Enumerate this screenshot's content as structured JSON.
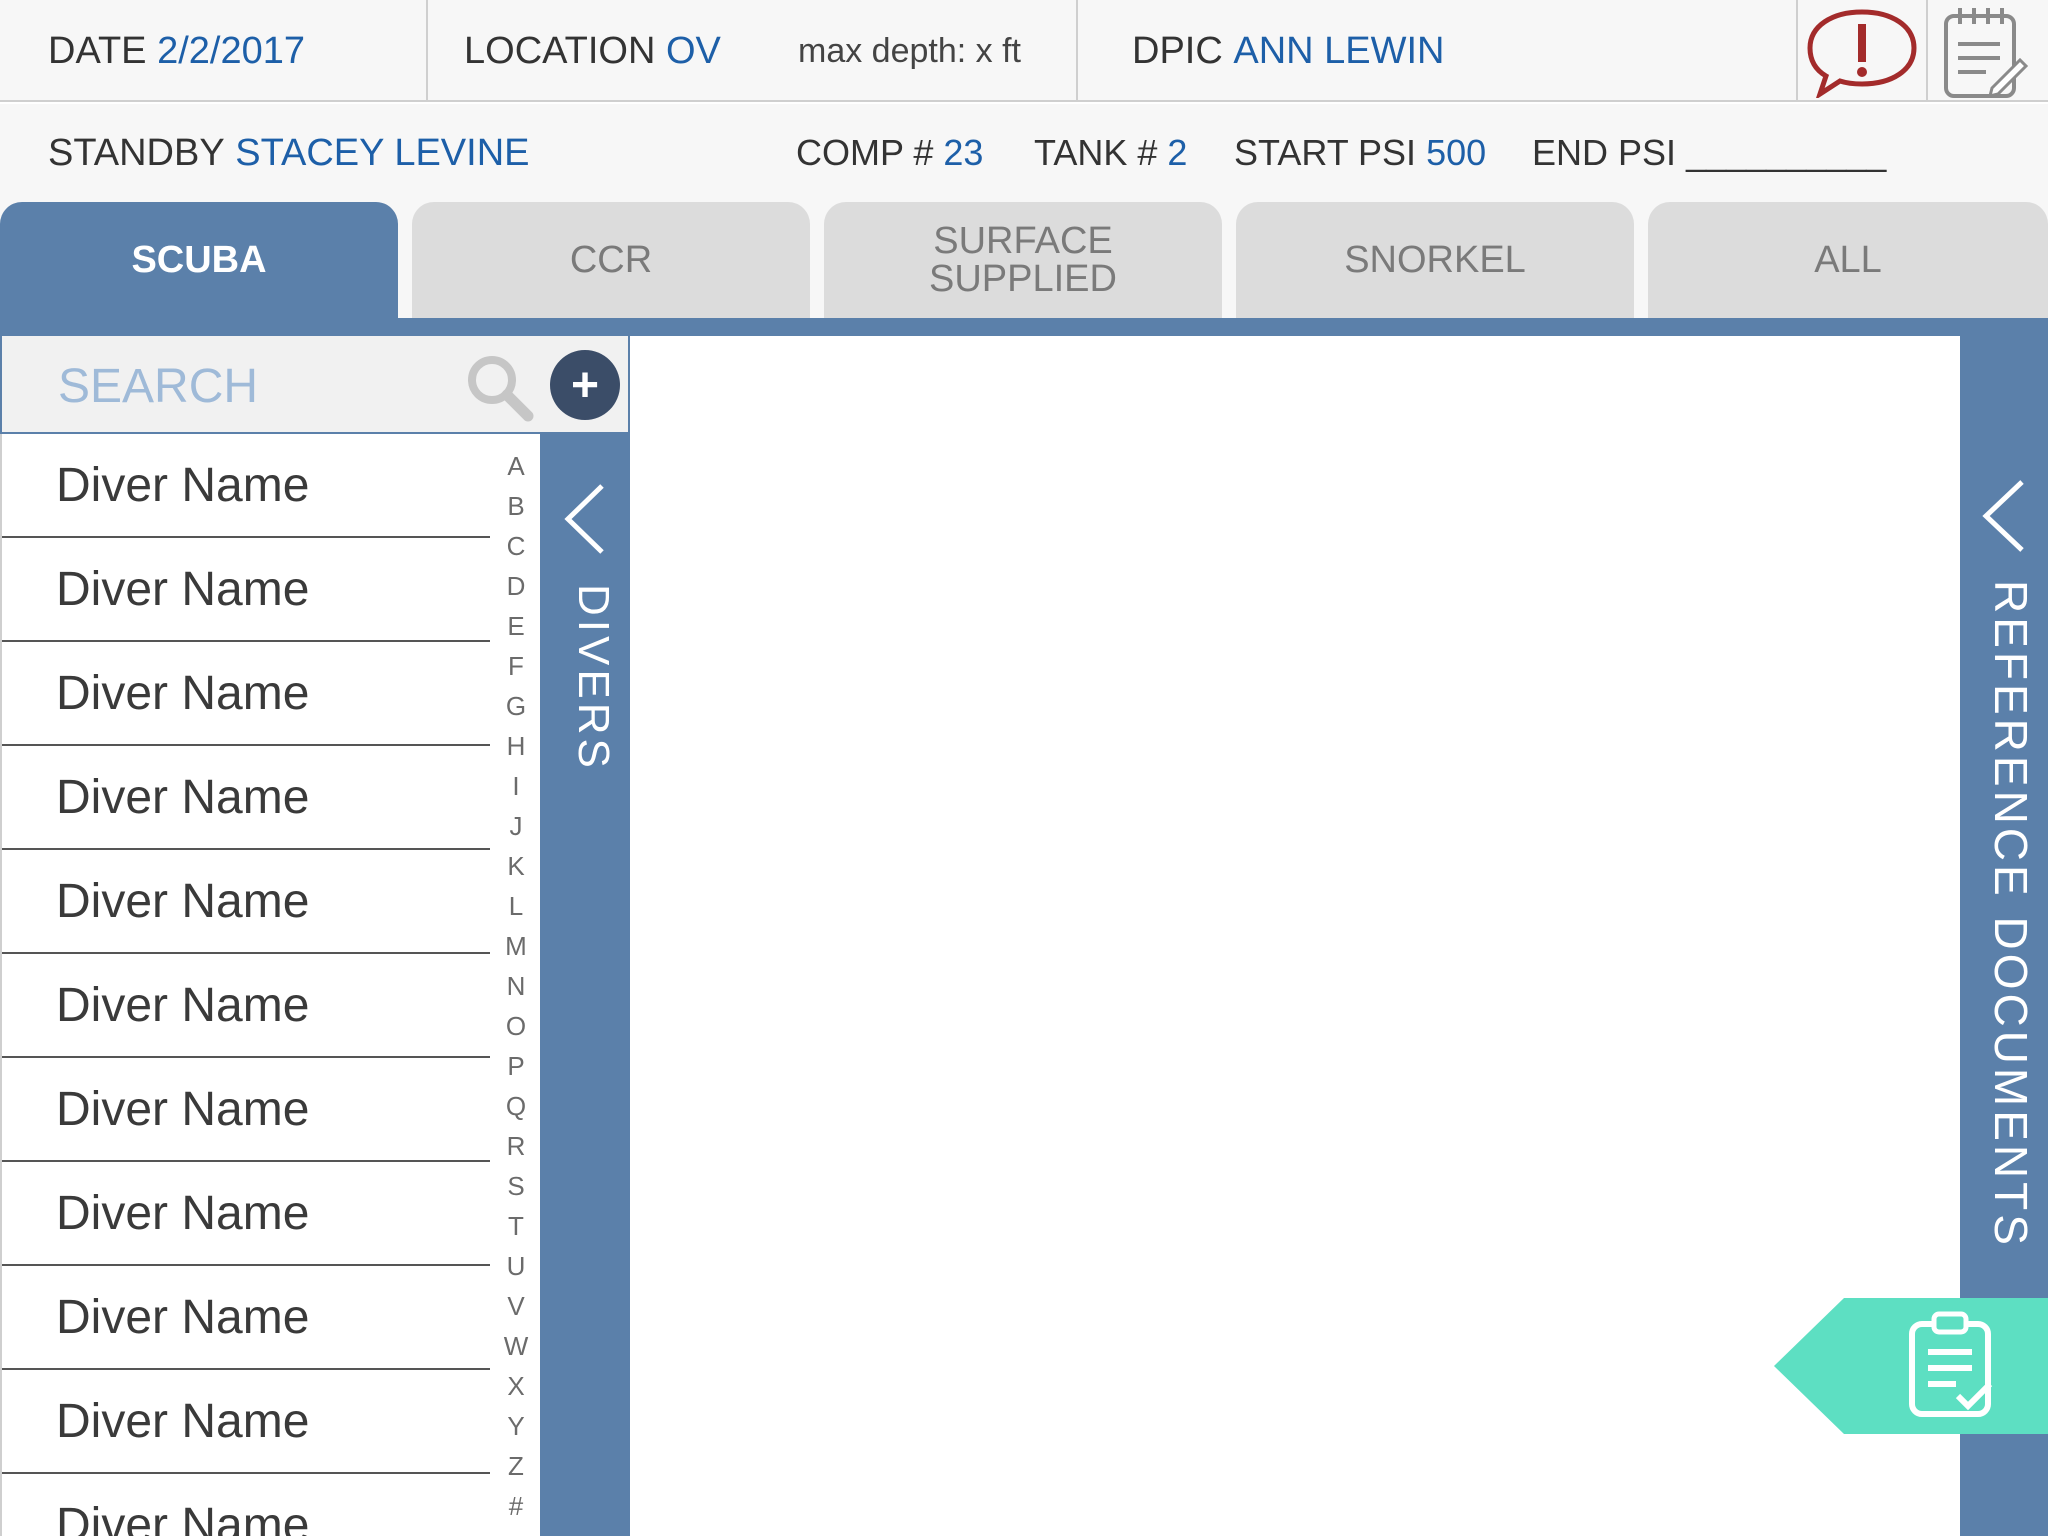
{
  "header": {
    "date_label": "DATE",
    "date_value": "2/2/2017",
    "location_label": "LOCATION",
    "location_value": "OV",
    "max_depth": "max depth: x ft",
    "dpic_label": "DPIC",
    "dpic_value": "ANN LEWIN",
    "standby_label": "STANDBY",
    "standby_value": "STACEY LEVINE",
    "comp_label": "COMP #",
    "comp_value": "23",
    "tank_label": "TANK #",
    "tank_value": "2",
    "start_psi_label": "START PSI",
    "start_psi_value": "500",
    "end_psi_label": "END PSI",
    "end_psi_blank": "__________"
  },
  "tabs": [
    {
      "label": "SCUBA",
      "active": true
    },
    {
      "label": "CCR",
      "active": false
    },
    {
      "label": "SURFACE SUPPLIED",
      "active": false
    },
    {
      "label": "SNORKEL",
      "active": false
    },
    {
      "label": "ALL",
      "active": false
    }
  ],
  "search": {
    "placeholder": "SEARCH",
    "add_label": "+"
  },
  "divers": [
    "Diver Name",
    "Diver Name",
    "Diver Name",
    "Diver Name",
    "Diver Name",
    "Diver Name",
    "Diver Name",
    "Diver Name",
    "Diver Name",
    "Diver Name",
    "Diver Name"
  ],
  "alpha_index": [
    "A",
    "B",
    "C",
    "D",
    "E",
    "F",
    "G",
    "H",
    "I",
    "J",
    "K",
    "L",
    "M",
    "N",
    "O",
    "P",
    "Q",
    "R",
    "S",
    "T",
    "U",
    "V",
    "W",
    "X",
    "Y",
    "Z",
    "#"
  ],
  "side_tabs": {
    "divers": "DIVERS",
    "reference": "REFERENCE DOCUMENTS"
  },
  "icons": {
    "alert": "alert-speech-bubble-icon",
    "notes": "notepad-icon",
    "search": "search-icon",
    "checklist": "clipboard-check-icon"
  },
  "colors": {
    "accent_blue": "#5b80aa",
    "value_blue": "#1d5fa8",
    "teal": "#5ddfc2",
    "alert_red": "#a32b2b"
  }
}
